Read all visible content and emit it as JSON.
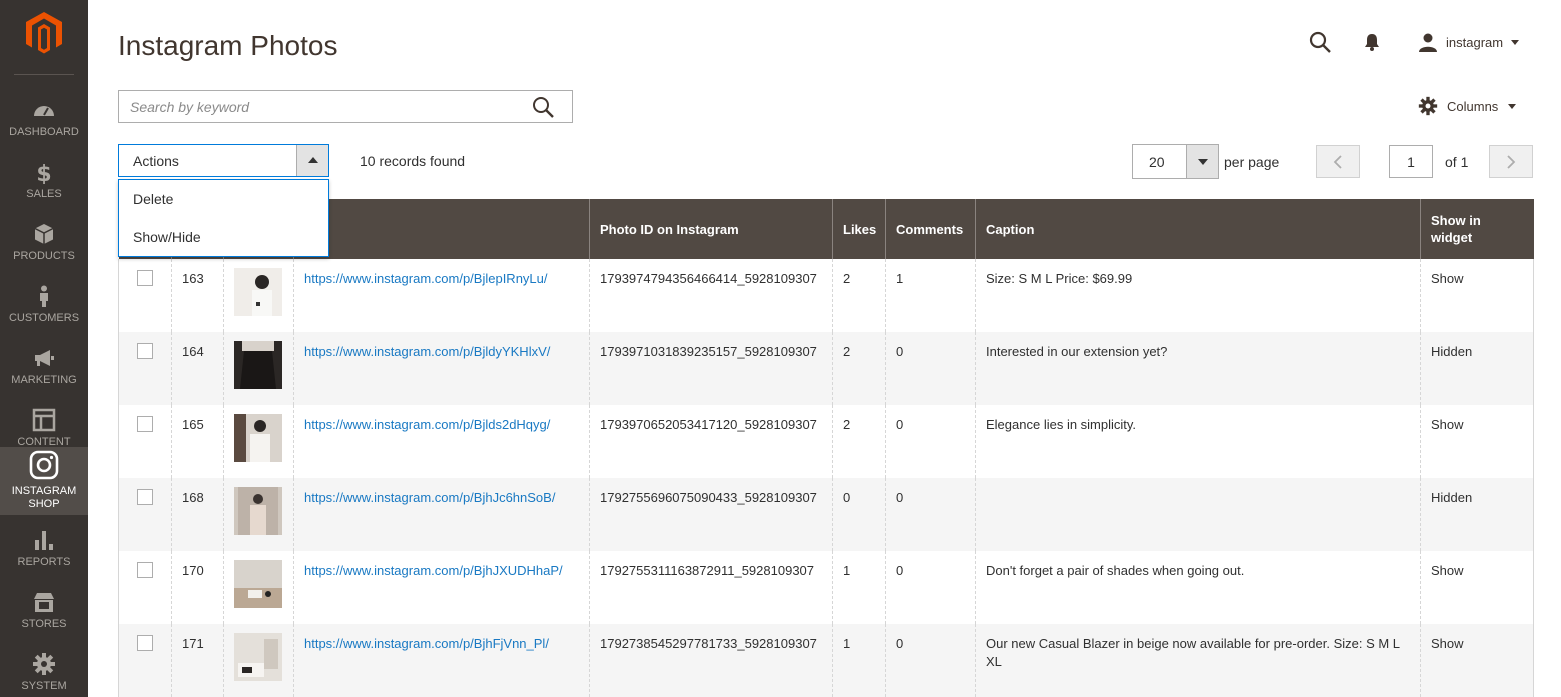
{
  "page": {
    "title": "Instagram Photos"
  },
  "header": {
    "user_name": "instagram"
  },
  "sidebar": {
    "items": [
      {
        "label": "DASHBOARD",
        "icon": "dashboard-icon"
      },
      {
        "label": "SALES",
        "icon": "dollar-icon"
      },
      {
        "label": "PRODUCTS",
        "icon": "cube-icon"
      },
      {
        "label": "CUSTOMERS",
        "icon": "person-icon"
      },
      {
        "label": "MARKETING",
        "icon": "megaphone-icon"
      },
      {
        "label": "CONTENT",
        "icon": "layout-icon"
      },
      {
        "label": "INSTAGRAM SHOP",
        "icon": "instagram-icon",
        "active": true
      },
      {
        "label": "REPORTS",
        "icon": "bar-chart-icon"
      },
      {
        "label": "STORES",
        "icon": "store-icon"
      },
      {
        "label": "SYSTEM",
        "icon": "gear-icon"
      }
    ]
  },
  "search": {
    "placeholder": "Search by keyword"
  },
  "toolbar": {
    "columns_label": "Columns",
    "actions_label": "Actions",
    "actions_options": [
      "Delete",
      "Show/Hide"
    ],
    "records_found": "10 records found",
    "per_page_value": "20",
    "per_page_label": "per page",
    "current_page": "1",
    "page_of": "of 1"
  },
  "table": {
    "headers": {
      "photo_id": "Photo ID on Instagram",
      "likes": "Likes",
      "comments": "Comments",
      "caption": "Caption",
      "show_in_widget": "Show in widget"
    },
    "rows": [
      {
        "id": "163",
        "link": "https://www.instagram.com/p/BjlepIRnyLu/",
        "photo_id": "1793974794356466414_5928109307",
        "likes": "2",
        "comments": "1",
        "caption": "Size: S M L Price: $69.99",
        "widget": "Show"
      },
      {
        "id": "164",
        "link": "https://www.instagram.com/p/BjldyYKHlxV/",
        "photo_id": "1793971031839235157_5928109307",
        "likes": "2",
        "comments": "0",
        "caption": "Interested in our extension yet?",
        "widget": "Hidden"
      },
      {
        "id": "165",
        "link": "https://www.instagram.com/p/Bjlds2dHqyg/",
        "photo_id": "1793970652053417120_5928109307",
        "likes": "2",
        "comments": "0",
        "caption": "Elegance lies in simplicity.",
        "widget": "Show"
      },
      {
        "id": "168",
        "link": "https://www.instagram.com/p/BjhJc6hnSoB/",
        "photo_id": "1792755696075090433_5928109307",
        "likes": "0",
        "comments": "0",
        "caption": "",
        "widget": "Hidden"
      },
      {
        "id": "170",
        "link": "https://www.instagram.com/p/BjhJXUDHhaP/",
        "photo_id": "1792755311163872911_5928109307",
        "likes": "1",
        "comments": "0",
        "caption": "Don't forget a pair of shades when going out.",
        "widget": "Show"
      },
      {
        "id": "171",
        "link": "https://www.instagram.com/p/BjhFjVnn_Pl/",
        "photo_id": "1792738545297781733_5928109307",
        "likes": "1",
        "comments": "0",
        "caption": "Our new Casual Blazer in beige now available for pre-order. Size: S M L XL",
        "widget": "Show"
      }
    ]
  },
  "colors": {
    "sidebar_bg": "#373330",
    "sidebar_active": "#524d49",
    "header_bg": "#514943",
    "link": "#1979c3",
    "brand": "#eb5202",
    "focus_border": "#007bdb"
  }
}
